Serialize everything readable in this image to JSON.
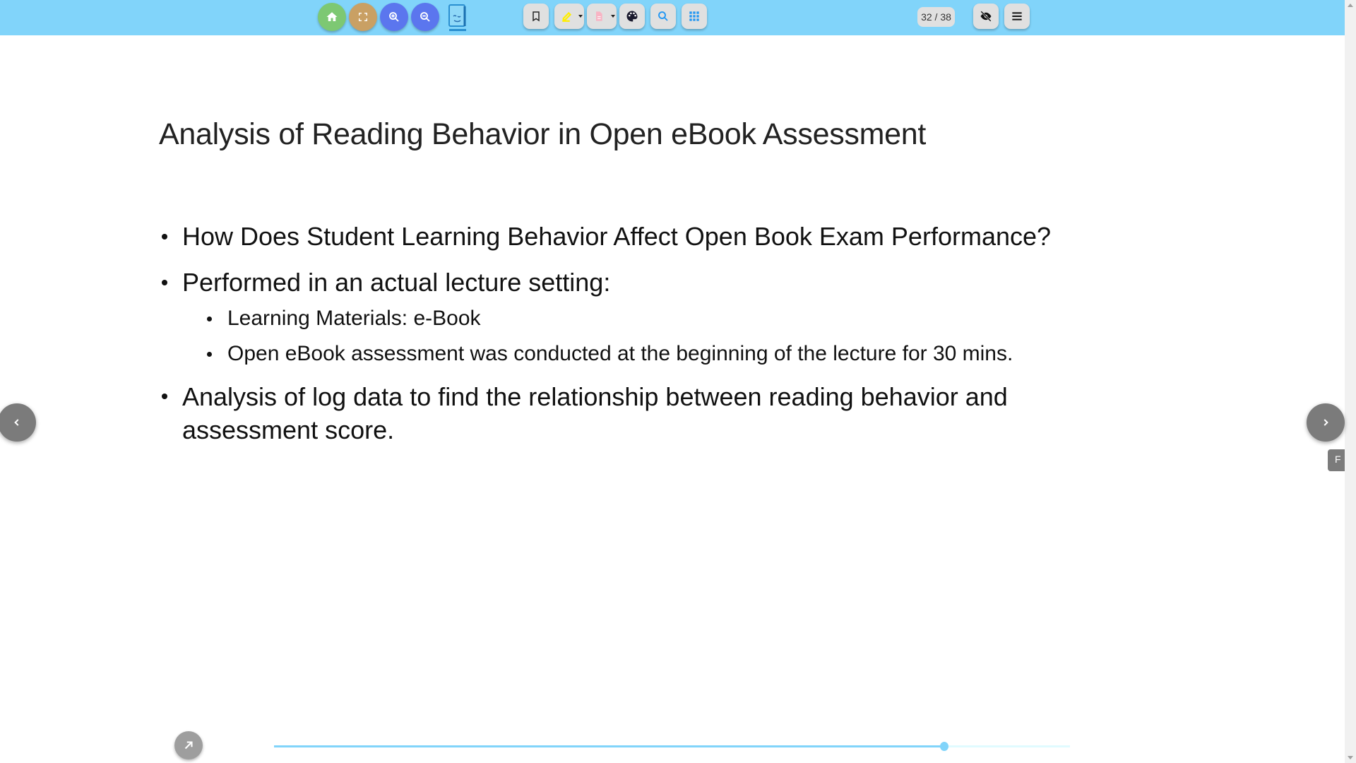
{
  "toolbar": {
    "icons": [
      "home-icon",
      "fullscreen-icon",
      "zoom-in-icon",
      "zoom-out-icon",
      "app-logo",
      "bookmark-icon",
      "highlighter-icon",
      "note-icon",
      "palette-icon",
      "search-icon",
      "grid-icon",
      "eye-off-icon",
      "menu-icon"
    ],
    "page_counter": "32 / 38",
    "colors": {
      "bar": "#81d4fa",
      "home": "#7dc873",
      "fullscreen": "#c9a064",
      "zoom": "#5b76ee",
      "highlighter": "#ffee00",
      "note": "#f8b4c4",
      "search": "#2196f3",
      "grid": "#2196f3"
    }
  },
  "slide": {
    "title": "Analysis of Reading Behavior in Open eBook Assessment",
    "bullets": [
      {
        "text": "How Does Student Learning Behavior Affect Open Book Exam Performance?"
      },
      {
        "text": "Performed in an actual lecture setting:",
        "sub": [
          "Learning Materials: e-Book",
          "Open eBook assessment was conducted at the beginning of the lecture for 30 mins."
        ]
      },
      {
        "text": "Analysis of log data to find the relationship between reading behavior and assessment score."
      }
    ]
  },
  "side_tab": "F",
  "progress": {
    "current_page": 32,
    "total_pages": 38
  }
}
